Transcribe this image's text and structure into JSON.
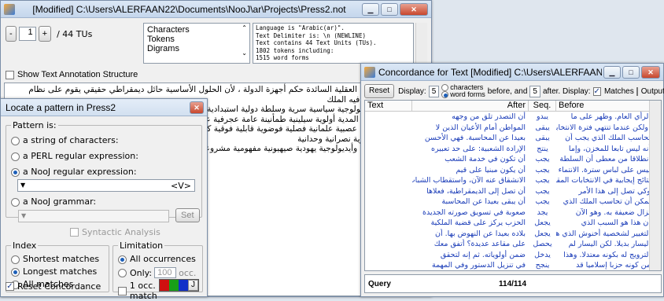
{
  "main_window": {
    "title": "[Modified] C:\\Users\\ALERFAAN22\\Documents\\NooJ\\ar\\Projects\\Press2.not",
    "tu_index": "1",
    "tu_total": "/ 44 TUs",
    "annotation_list": [
      "Characters",
      "Tokens",
      "Digrams"
    ],
    "info_lines": [
      "Language is \"Arabic(ar)\".",
      "Text Delimiter is: \\n (NEWLINE)",
      "Text contains 44 Text Units (TUs).",
      "1802 tokens including:",
      "1515 word forms"
    ],
    "show_structure_label": "Show Text Annotation Structure",
    "text_lines": [
      "بالاستقلال لكن العقلية السائدة حكم أجهزة الدولة ، لأن الحلول الأساسية حائل ديمقراطي حقيقي يقوم على نظام سياسي يخضع فيه الملك",
      "إستراتيجية أيديولوجية سياسية سرية وسلطة دولية استبدادية أوليغارشية ملكية أبوية مسؤولية بسائية مشمولية أغلبية أعضائية أكثرية المدية أولوية سيلينية طمأنينة عامة عجرفية عروبة عصرية عصبة",
      "عمالية عنصرية عصبية علمانية فصلية فوضوية قابلية فوقية كيفية لاصوصية مادية مدنية مغلولية ملاحية مأزومية موضوعية مولوية نصرانية وحدانية",
      "وطنية وتاريخية وأيديولوجية يهودية صيهيونية مفهومية مشروعية أزدواجية مقروئية"
    ]
  },
  "locate_dialog": {
    "title": "Locate a pattern in Press2",
    "pattern_group": "Pattern is:",
    "opt_string": "a string of characters:",
    "opt_perl": "a PERL regular expression:",
    "opt_nooj_regex": "a NooJ regular expression:",
    "regex_value": "<V>",
    "opt_nooj_grammar": "a NooJ grammar:",
    "set_label": "Set",
    "syntactic_label": "Syntactic Analysis",
    "index_group": "Index",
    "idx_shortest": "Shortest matches",
    "idx_longest": "Longest matches",
    "idx_all": "All matches",
    "limitation_group": "Limitation",
    "lim_all": "All occurrences",
    "lim_only": "Only:",
    "lim_only_value": "100",
    "lim_occ": "occ.",
    "lim_per_match": "1 occ. per match",
    "reset_concordance": "Reset Concordance",
    "color_swatches": [
      "#d01010",
      "#18a018",
      "#1030c8"
    ],
    "action_label": "J"
  },
  "concordance": {
    "title": "Concordance for Text [Modified] C:\\Users\\ALERFAAN22\\Docu...",
    "reset_label": "Reset",
    "display_label": "Display:",
    "before_value": "5",
    "unit_characters": "characters",
    "unit_words": "word forms",
    "before_after_label": "before, and",
    "after_value": "5",
    "after_display_label": "after. Display:",
    "matches_label": "Matches",
    "outputs_label": "Outputs",
    "col_text": "Text",
    "col_after": "After",
    "col_seq": "Seq.",
    "col_before": "Before",
    "rows": [
      {
        "after": "أن التصدر تلق من وجهه",
        "seq": "يبدو",
        "before": "الرأي العام. وظهر على ما"
      },
      {
        "after": "المواطن أمام الأعيان الذين لا",
        "seq": "يبقى",
        "before": ".ولكن عندما تنتهي فترة الانتخابات"
      },
      {
        "after": "بعيدا عن المحاسبة. فهي الأحسن",
        "seq": "يبقى",
        "before": "تحاسب الملك الذي يجب أن"
      },
      {
        "after": "الإرادة الشعبية: على حد تعبيره",
        "seq": "ينتج",
        "before": "أنه ليس تابعا للمخزن، وإما"
      },
      {
        "after": "أن تكون في خدمة الشعب",
        "seq": "يجب",
        "before": "انطلاقا من معطى أن السلطة"
      },
      {
        "after": "أن يكون مبنيا على قيم",
        "seq": "يجب",
        "before": "ليس على لباس سترة. الانتماء"
      },
      {
        "after": "الانشقاق عنه الآن، واستقطاب الشباب",
        "seq": "يجب",
        "before": "نتائج إيجابية في الانتخابات المقبلة"
      },
      {
        "after": "أن تصل إلى الديمقراطية، فعلاها",
        "seq": "يجب",
        "before": "وكي تصل إلى هذا الأمر"
      },
      {
        "after": "أن يبقى بعيدا عن المحاسبة",
        "seq": "يجب",
        "before": "يمكن أن تحاسب الملك الذي"
      },
      {
        "after": "صعوبة في تسويق صورته الجديدة",
        "seq": "يجد",
        "before": "تزال ضعيفة به. وهو الآن"
      },
      {
        "after": "الحزب يركز على قضية الملكية",
        "seq": "يجعل",
        "before": "أن هذا هو السبب الذي"
      },
      {
        "after": "بلاده بعيدا عن النهوض بها. أن",
        "seq": "يجعل",
        "before": "التغيير لشخصية أخنوش الذي هو"
      },
      {
        "after": "على مقاعد عديدة؟ أتفق معك",
        "seq": "يحصل",
        "before": "اليسار بديلا. لكن اليسار لم"
      },
      {
        "after": "ضمن أولوياته. ثم إنه لتحقق",
        "seq": "يدخل",
        "before": "الترويج له بكونه معتدلا. وهذا"
      },
      {
        "after": "في تنزيل الدستور وفي المهمة",
        "seq": "ينجح",
        "before": "من كونه حزبا إسلاميا قد"
      }
    ],
    "query_label": "Query",
    "position_label": "114/114"
  }
}
